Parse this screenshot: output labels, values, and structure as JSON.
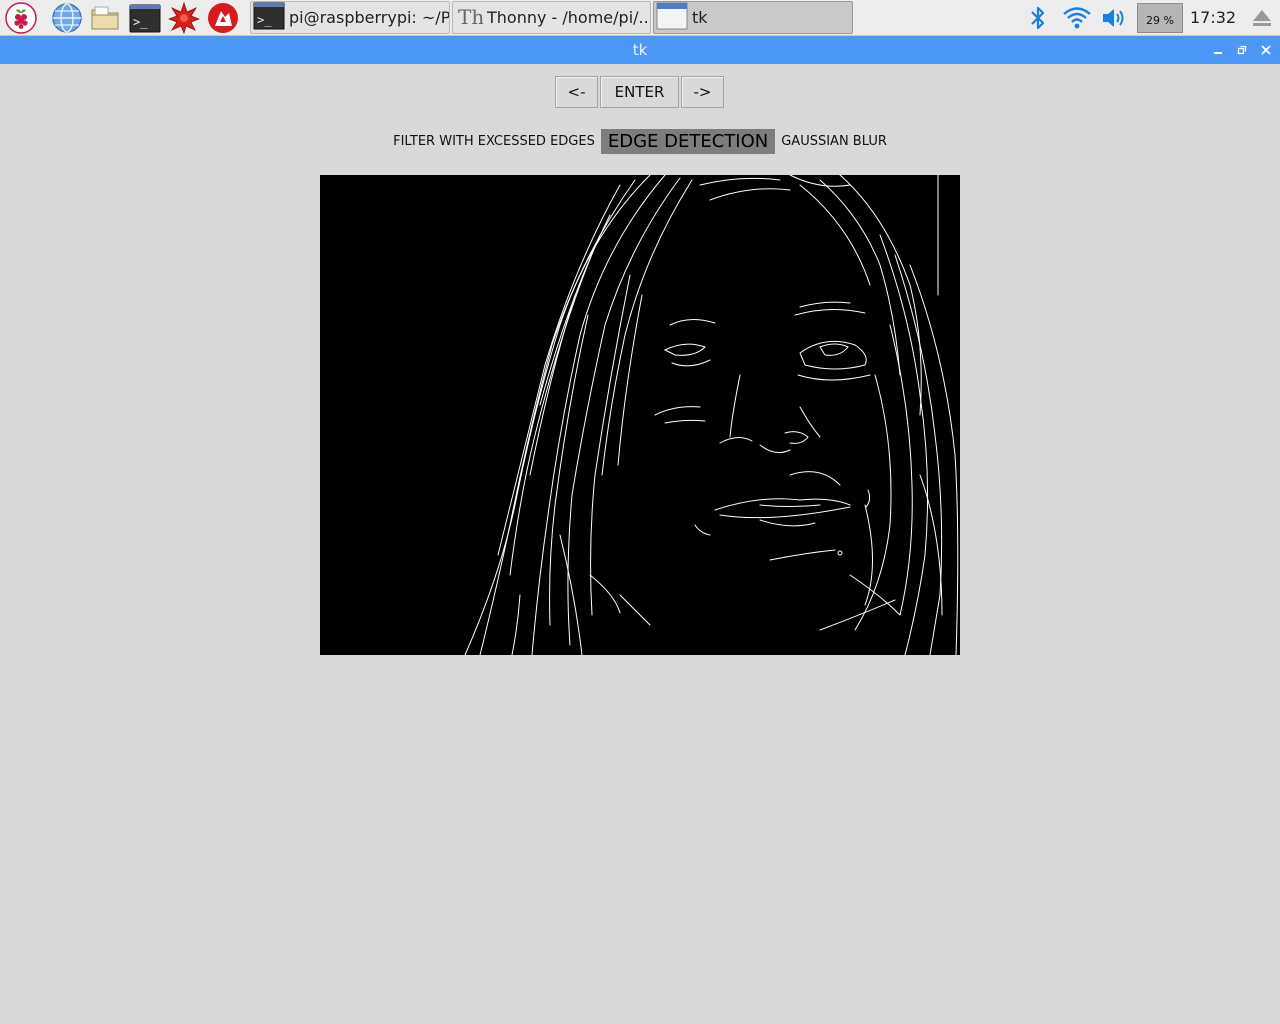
{
  "taskbar": {
    "launchers": [
      {
        "name": "raspberry-menu-icon"
      },
      {
        "name": "web-browser-icon"
      },
      {
        "name": "file-manager-icon"
      },
      {
        "name": "terminal-icon"
      },
      {
        "name": "mathematica-icon"
      },
      {
        "name": "wolfram-icon"
      }
    ],
    "tasks": [
      {
        "label": "pi@raspberrypi: ~/Pl...",
        "icon": "terminal-icon",
        "active": false
      },
      {
        "label": "Thonny  -  /home/pi/...",
        "icon": "thonny-icon",
        "active": false
      },
      {
        "label": "tk",
        "icon": "window-icon",
        "active": true
      }
    ],
    "battery": "29 %",
    "clock": "17:32"
  },
  "window": {
    "title": "tk"
  },
  "nav": {
    "prev": "<-",
    "enter": "ENTER",
    "next": "->"
  },
  "filters": [
    {
      "label": "FILTER WITH EXCESSED EDGES",
      "selected": false
    },
    {
      "label": "EDGE DETECTION",
      "selected": true
    },
    {
      "label": "GAUSSIAN BLUR",
      "selected": false
    }
  ],
  "image": {
    "description_icon": "edge-detected-portrait"
  },
  "colors": {
    "titlebar": "#4d98f5",
    "background": "#d9d9d9",
    "selected_filter": "#7d7d7d",
    "bluetooth": "#1a7fe0"
  }
}
